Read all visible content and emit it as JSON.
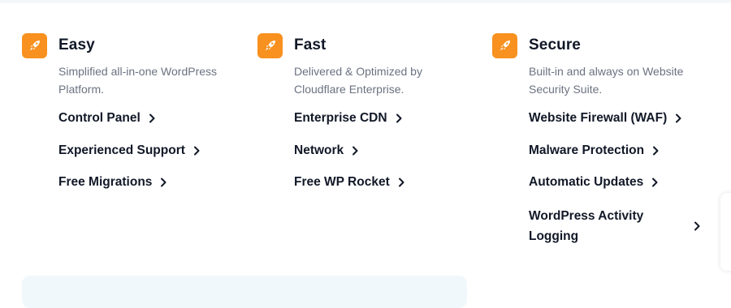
{
  "colors": {
    "accent": "#f8911f",
    "heading": "#111827",
    "muted": "#6b7280",
    "promo_bg": "#f1f8fb"
  },
  "columns": [
    {
      "icon": "rocket-icon",
      "title": "Easy",
      "description": "Simplified all-in-one WordPress Platform.",
      "links": [
        "Control Panel",
        "Experienced Support",
        "Free Migrations"
      ]
    },
    {
      "icon": "rocket-icon",
      "title": "Fast",
      "description": "Delivered & Optimized by Cloudflare Enterprise.",
      "links": [
        "Enterprise CDN",
        "Network",
        "Free WP Rocket"
      ]
    },
    {
      "icon": "rocket-icon",
      "title": "Secure",
      "description": "Built-in and always on Website Security Suite.",
      "links": [
        "Website Firewall (WAF)",
        "Malware Protection",
        "Automatic Updates",
        "WordPress Activity Logging"
      ]
    }
  ]
}
